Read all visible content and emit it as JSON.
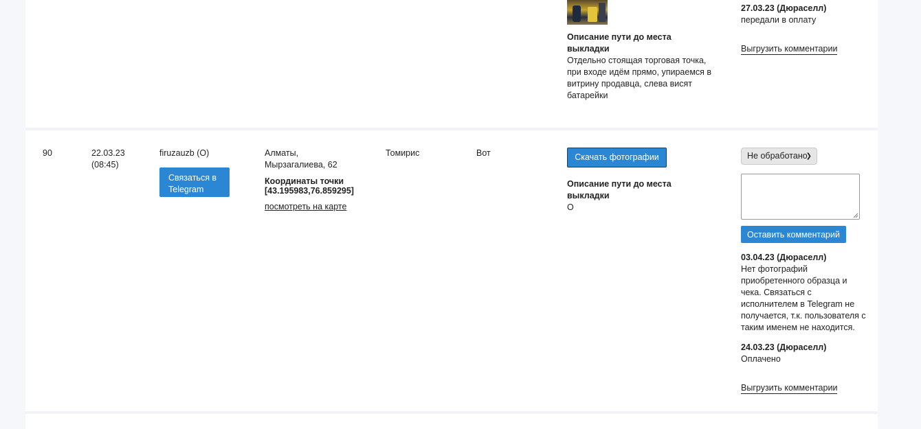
{
  "row_prev": {
    "comment_date": "27.03.23 (Дюраселл)",
    "comment_text": "передали в оплату",
    "export_comments": "Выгрузить комментарии",
    "route_title_line1": "Описание пути до места",
    "route_title_line2": "выкладки",
    "route_desc_lines": [
      "Отдельно стоящая торговая точка,",
      "при входе идём прямо, упираемся в",
      "витрину продавца, слева висят",
      "батарейки"
    ]
  },
  "row": {
    "id": "90",
    "date": "22.03.23",
    "time": "(08:45)",
    "user": "firuzauzb (O)",
    "telegram_btn_line1": "Связаться в",
    "telegram_btn_line2": "Telegram",
    "address_line1": "Алматы,",
    "address_line2": "Мырзагалиева, 62",
    "coords_label": "Координаты точки",
    "coords_value": "[43.195983,76.859295]",
    "map_link": "посмотреть на карте",
    "store": "Томирис",
    "product": "Вот",
    "download_photos": "Скачать фотографии",
    "route_title_line1": "Описание пути до места",
    "route_title_line2": "выкладки",
    "route_desc": "О",
    "status_selected": "Не обработано",
    "comment_placeholder": "",
    "leave_comment": "Оставить комментарий",
    "comments": [
      {
        "date": "03.04.23 (Дюраселл)",
        "lines": [
          "Нет фотографий",
          "приобретенного образца и",
          "чека. Связаться с",
          "исполнителем в Telegram не",
          "получается, т.к. пользователя с",
          "таким именем не находится."
        ]
      },
      {
        "date": "24.03.23 (Дюраселл)",
        "lines": [
          "Оплачено"
        ]
      }
    ],
    "export_comments": "Выгрузить комментарии"
  }
}
